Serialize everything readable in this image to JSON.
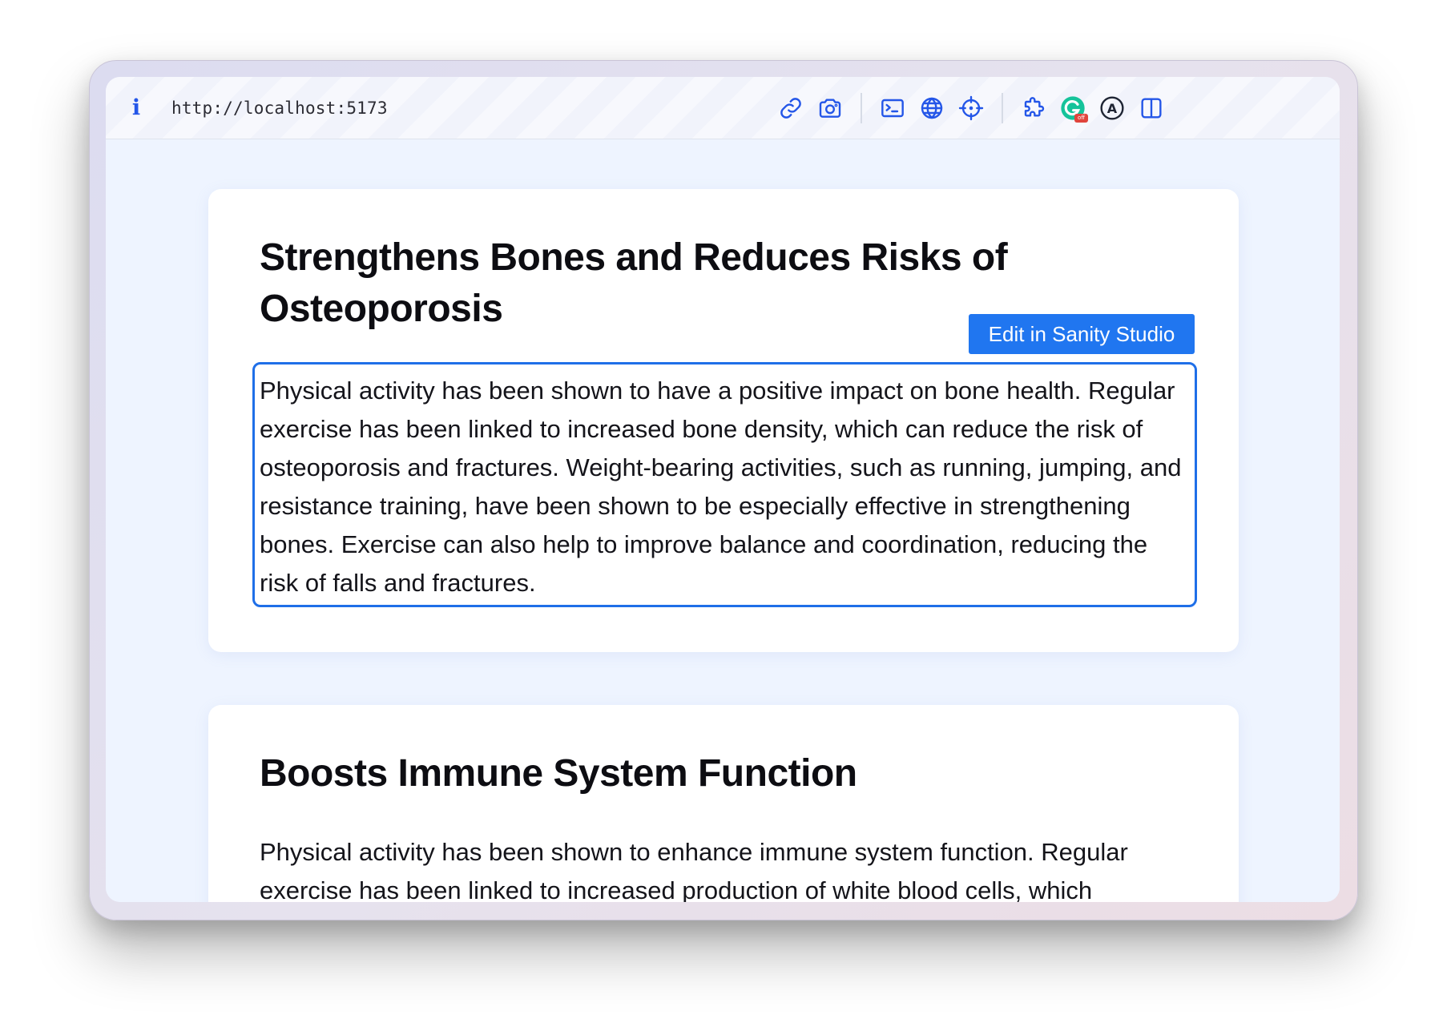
{
  "browser": {
    "url": "http://localhost:5173",
    "info_icon": "i",
    "grammarly_badge": "off",
    "accessibility_letter": "A",
    "icons": [
      "info-icon",
      "link-icon",
      "camera-icon",
      "terminal-icon",
      "globe-icon",
      "crosshair-icon",
      "puzzle-icon",
      "grammarly-icon",
      "accessibility-icon",
      "sidebar-icon"
    ]
  },
  "articles": [
    {
      "title": "Strengthens Bones and Reduces Risks of Osteoporosis",
      "body": "Physical activity has been shown to have a positive impact on bone health. Regular exercise has been linked to increased bone density, which can reduce the risk of osteoporosis and fractures. Weight-bearing activities, such as running, jumping, and resistance training, have been shown to be especially effective in strengthening bones. Exercise can also help to improve balance and coordination, reducing the risk of falls and fractures.",
      "edit_label": "Edit in Sanity Studio"
    },
    {
      "title": "Boosts Immune System Function",
      "body": "Physical activity has been shown to enhance immune system function. Regular exercise has been linked to increased production of white blood cells, which"
    }
  ],
  "colors": {
    "accent": "#2076f0",
    "highlight": "#1f6fe8",
    "page_background": "#eef4ff",
    "icon": "#2456e8"
  }
}
